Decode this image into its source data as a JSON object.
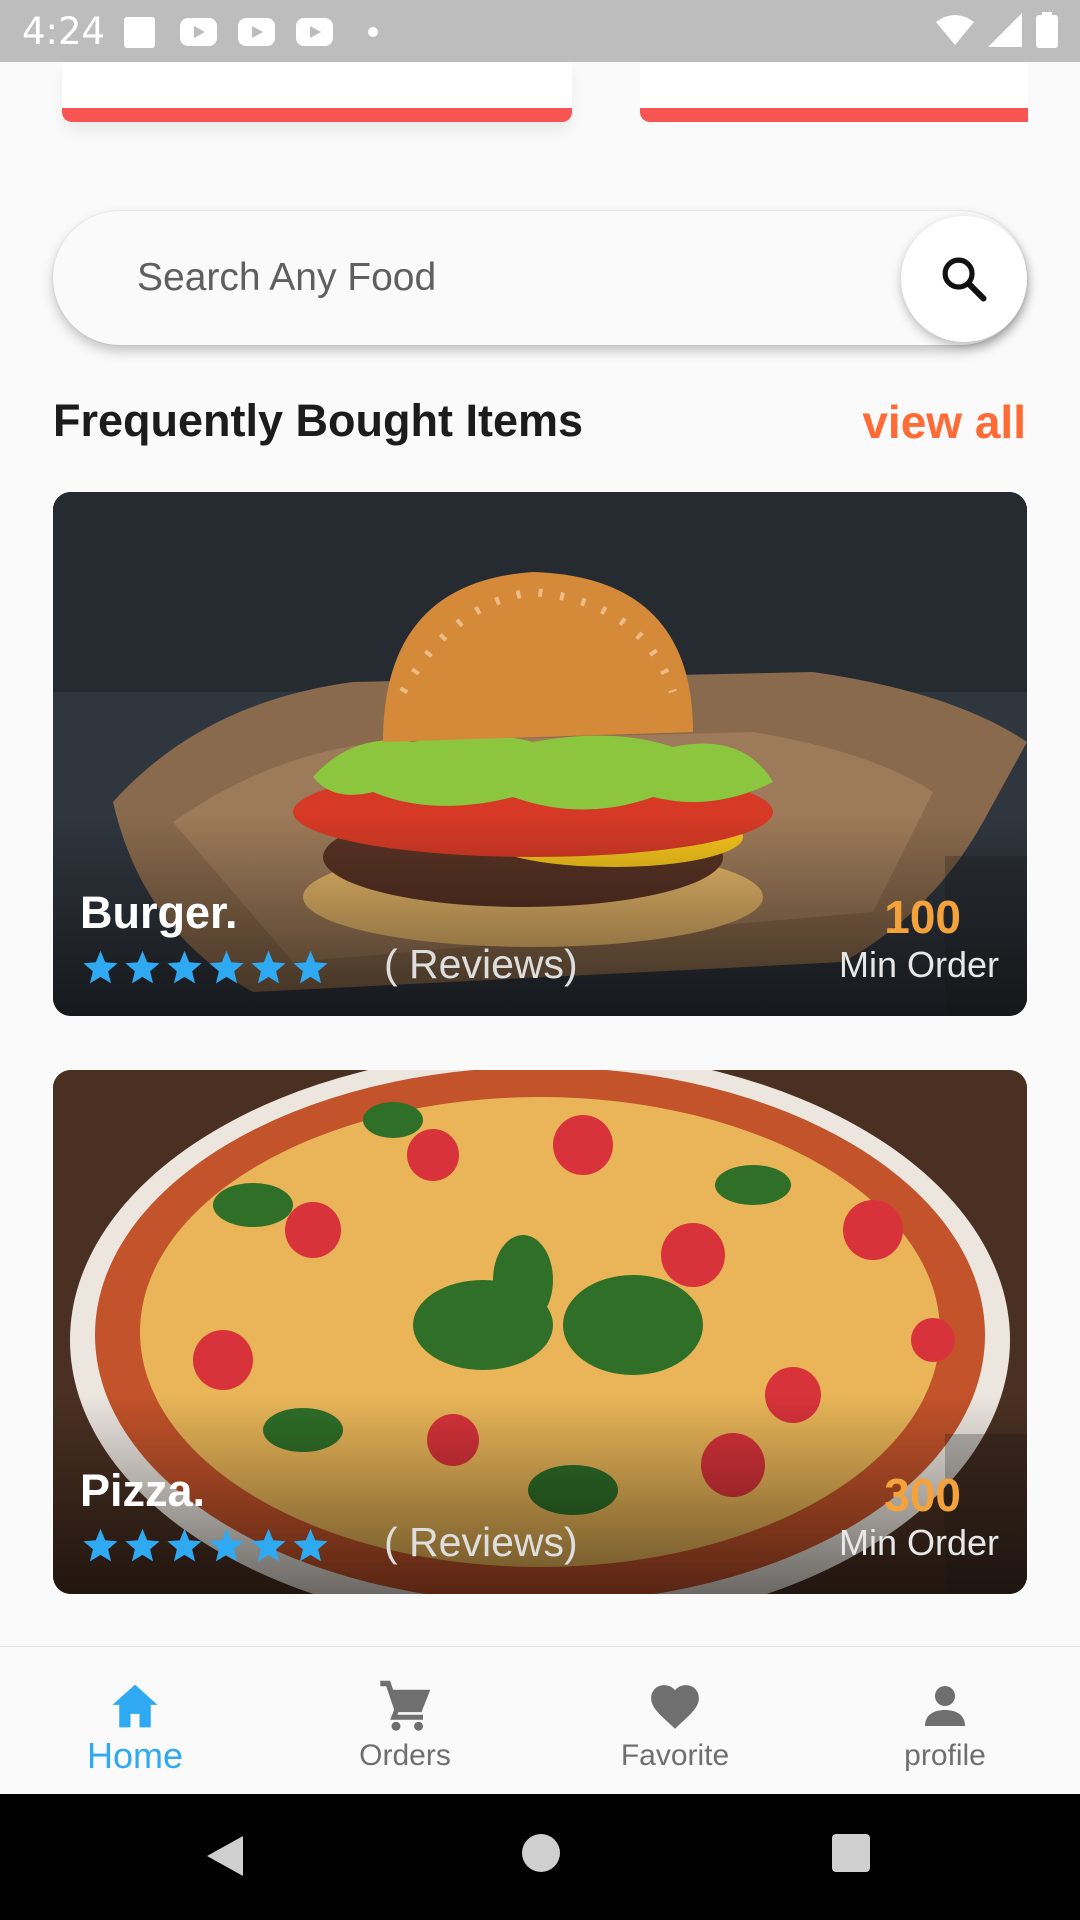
{
  "status_bar": {
    "time": "4:24",
    "icons": [
      "notification-square-icon",
      "youtube-icon",
      "youtube-icon",
      "youtube-icon",
      "dot-icon",
      "wifi-icon",
      "cell-signal-icon",
      "battery-icon"
    ]
  },
  "search": {
    "placeholder": "Search Any Food",
    "icon": "search-icon"
  },
  "section": {
    "title": "Frequently Bought Items",
    "view_all": "view all"
  },
  "items": [
    {
      "name": "Burger.",
      "rating_stars": 6,
      "reviews": "( Reviews)",
      "price": "100",
      "price_caption": "Min Order"
    },
    {
      "name": "Pizza.",
      "rating_stars": 6,
      "reviews": "( Reviews)",
      "price": "300",
      "price_caption": "Min Order"
    }
  ],
  "bottom_nav": [
    {
      "label": "Home",
      "icon": "home-icon",
      "active": true
    },
    {
      "label": "Orders",
      "icon": "cart-icon",
      "active": false
    },
    {
      "label": "Favorite",
      "icon": "heart-icon",
      "active": false
    },
    {
      "label": "profile",
      "icon": "person-icon",
      "active": false
    }
  ],
  "colors": {
    "accent": "#2fa9f2",
    "view_all": "#ff6a35",
    "price": "#f3a23c",
    "promo_bar": "#f75452",
    "star": "#2fa9f2"
  }
}
